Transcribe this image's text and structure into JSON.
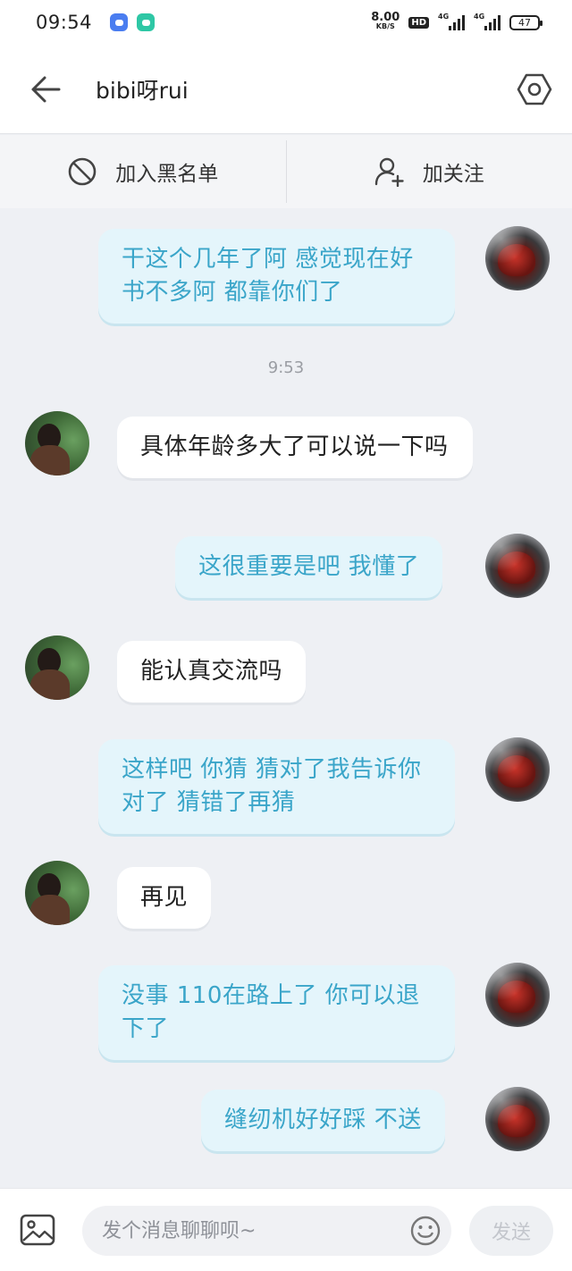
{
  "status_bar": {
    "time": "09:54",
    "net_speed": "8.00",
    "net_unit": "KB/S",
    "hd": "HD",
    "signal_label_1": "4G",
    "signal_label_2": "4G",
    "battery": "47"
  },
  "header": {
    "title": "bibi呀rui"
  },
  "actions": {
    "block_label": "加入黑名单",
    "follow_label": "加关注"
  },
  "messages": [
    {
      "side": "me",
      "text": "干这个几年了阿 感觉现在好书不多阿 都靠你们了"
    },
    {
      "side": "other",
      "text": "具体年龄多大了可以说一下吗"
    },
    {
      "side": "me",
      "text": "这很重要是吧 我懂了"
    },
    {
      "side": "other",
      "text": "能认真交流吗"
    },
    {
      "side": "me",
      "text": "这样吧 你猜 猜对了我告诉你对了 猜错了再猜"
    },
    {
      "side": "other",
      "text": "再见"
    },
    {
      "side": "me",
      "text": "没事 110在路上了 你可以退下了"
    },
    {
      "side": "me",
      "text": "缝纫机好好踩 不送"
    }
  ],
  "timestamp": "9:53",
  "input": {
    "placeholder": "发个消息聊聊呗~",
    "value": "",
    "send_label": "发送"
  },
  "colors": {
    "my_bubble_bg": "#e4f5fb",
    "my_bubble_text": "#3aa5c9",
    "other_bubble_bg": "#ffffff",
    "chat_bg": "#eef0f4"
  },
  "icons": [
    "back-arrow-icon",
    "settings-hex-icon",
    "block-icon",
    "add-user-icon",
    "image-icon",
    "emoji-icon"
  ]
}
